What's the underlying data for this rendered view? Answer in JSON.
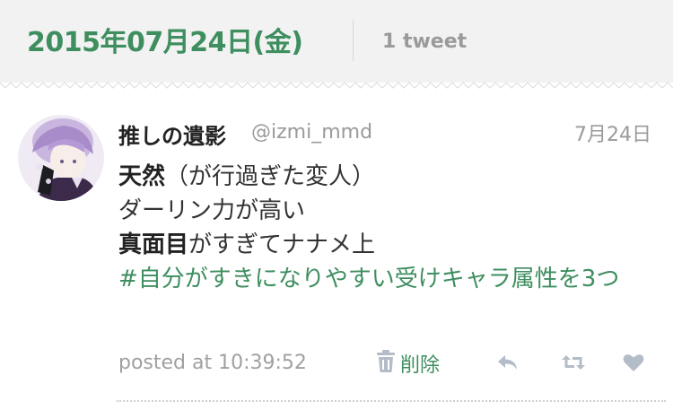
{
  "header": {
    "date": "2015年07月24日(金)",
    "tweet_count": "1 tweet"
  },
  "tweet": {
    "display_name": "推しの遺影",
    "handle": "@izmi_mmd",
    "date": "7月24日",
    "lines": {
      "l1_bold": "天然",
      "l1_rest": "（が行過ぎた変人）",
      "l2": "ダーリン力が高い",
      "l3_bold": "真面目",
      "l3_rest": "がすぎてナナメ上",
      "hashtag": "#自分がすきになりやすい受けキャラ属性を3つ"
    },
    "posted_at": "posted at 10:39:52",
    "delete_label": "削除"
  },
  "icons": {
    "delete": "trash-icon",
    "reply": "reply-icon",
    "retweet": "retweet-icon",
    "like": "heart-icon"
  },
  "colors": {
    "accent": "#3e8e5f",
    "muted": "#9a9a9a",
    "icon": "#b4bcc8"
  }
}
